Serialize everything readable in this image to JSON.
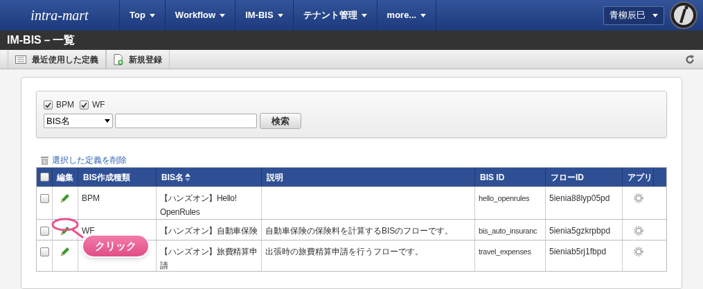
{
  "header": {
    "logo": "intra-mart",
    "nav": [
      {
        "label": "Top"
      },
      {
        "label": "Workflow"
      },
      {
        "label": "IM-BIS"
      },
      {
        "label": "テナント管理"
      },
      {
        "label": "more..."
      }
    ],
    "user": "青柳辰巳"
  },
  "page_title": "IM-BIS－一覧",
  "toolbar": [
    {
      "label": "最近使用した定義",
      "kind": "list"
    },
    {
      "label": "新規登録",
      "kind": "new"
    }
  ],
  "filter": {
    "checkboxes": [
      {
        "label": "BPM",
        "checked": true
      },
      {
        "label": "WF",
        "checked": true
      }
    ],
    "select": "BIS名",
    "button": "検索"
  },
  "delete_link": "選択した定義を削除",
  "table": {
    "select_all_checked": false,
    "columns": [
      "編集",
      "BIS作成種類",
      "BIS名",
      "説明",
      "BIS ID",
      "フローID",
      "アプリ"
    ],
    "rows": [
      {
        "checked": false,
        "type": "BPM",
        "name": "【ハンズオン】Hello! OpenRules",
        "description": "",
        "bis_id": "hello_openrules",
        "flow_id": "5ienia88lyp05pd"
      },
      {
        "checked": false,
        "type": "WF",
        "name": "【ハンズオン】自動車保険",
        "description": "自動車保険の保険料を計算するBISのフローです。",
        "bis_id": "bis_auto_insuranc",
        "flow_id": "5ienia5gzkrpbpd"
      },
      {
        "checked": false,
        "name": "【ハンズオン】旅費精算申請",
        "description": "出張時の旅費精算申請を行うフローです。",
        "bis_id": "travel_expenses",
        "flow_id": "5ieniab5rj1fbpd"
      }
    ]
  },
  "callout": "クリック"
}
